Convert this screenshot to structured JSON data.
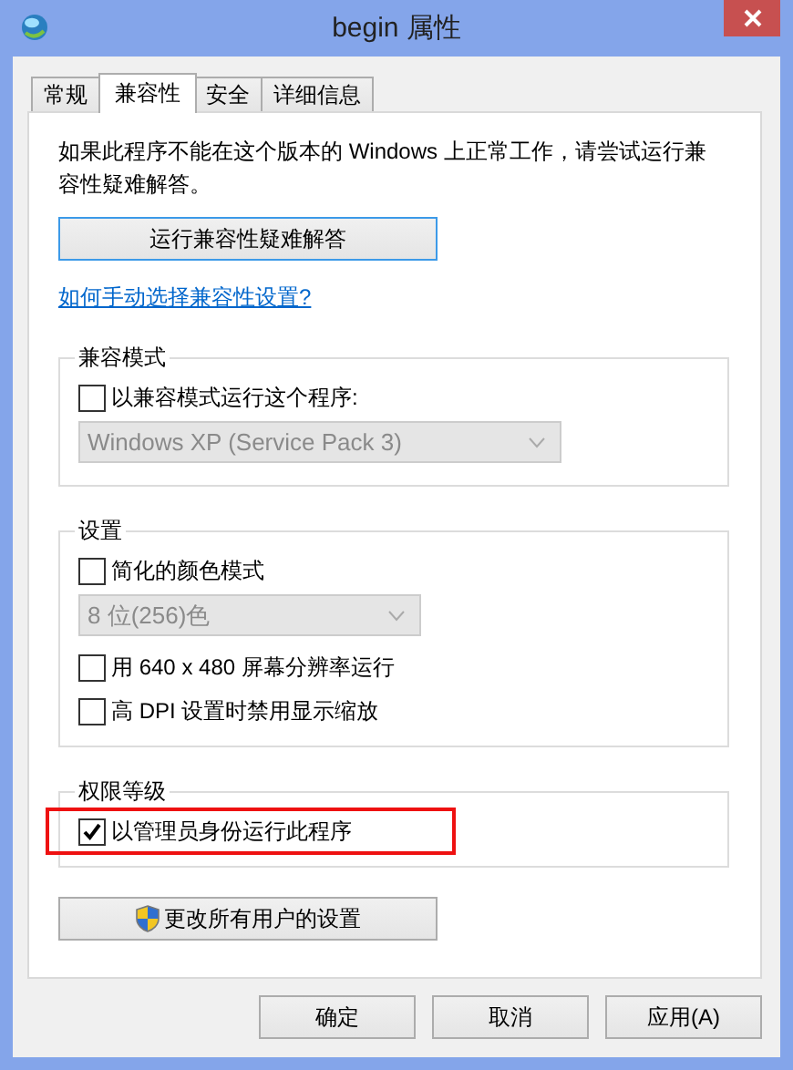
{
  "window": {
    "title": "begin 属性"
  },
  "tabs": [
    {
      "label": "常规",
      "selected": false
    },
    {
      "label": "兼容性",
      "selected": true
    },
    {
      "label": "安全",
      "selected": false
    },
    {
      "label": "详细信息",
      "selected": false
    }
  ],
  "description": "如果此程序不能在这个版本的 Windows 上正常工作，请尝试运行兼容性疑难解答。",
  "troubleshoot_button": "运行兼容性疑难解答",
  "help_link": "如何手动选择兼容性设置?",
  "groups": [
    {
      "title": "兼容模式",
      "items": [
        {
          "kind": "checkbox",
          "label": "以兼容模式运行这个程序:",
          "checked": false
        },
        {
          "kind": "dropdown",
          "value": "Windows XP (Service Pack 3)",
          "disabled": true
        }
      ]
    },
    {
      "title": "设置",
      "items": [
        {
          "kind": "checkbox",
          "label": "简化的颜色模式",
          "checked": false
        },
        {
          "kind": "dropdown",
          "value": "8 位(256)色",
          "disabled": true
        },
        {
          "kind": "checkbox",
          "label": "用 640 x 480 屏幕分辨率运行",
          "checked": false
        },
        {
          "kind": "checkbox",
          "label": "高 DPI 设置时禁用显示缩放",
          "checked": false
        }
      ]
    },
    {
      "title": "权限等级",
      "items": [
        {
          "kind": "checkbox",
          "label": "以管理员身份运行此程序",
          "checked": true,
          "highlighted": true
        }
      ]
    }
  ],
  "all_users_button": "更改所有用户的设置",
  "buttons": [
    "确定",
    "取消",
    "应用(A)"
  ]
}
